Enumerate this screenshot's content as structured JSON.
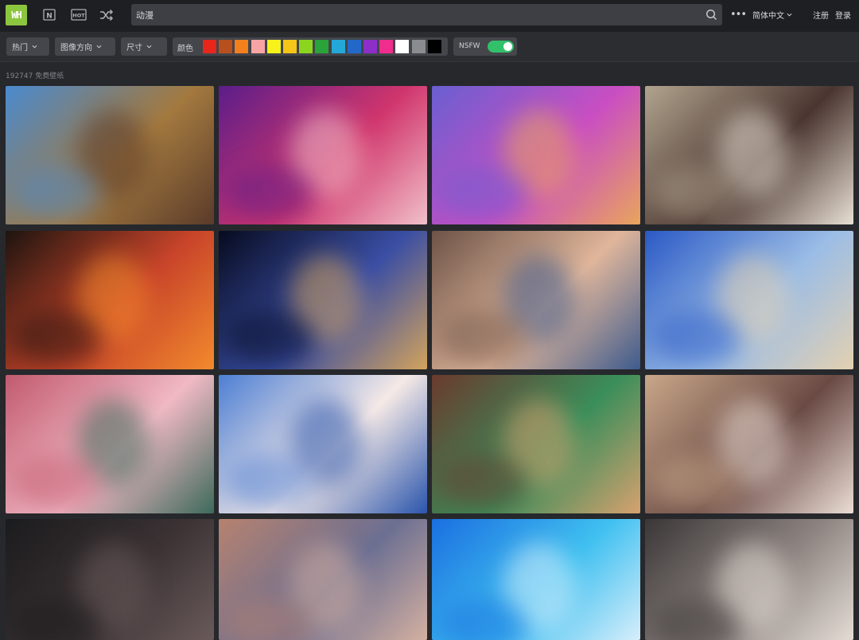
{
  "app": {
    "logo_text": "WH",
    "accent": "#8cc63e"
  },
  "nav": {
    "new_icon_label": "N",
    "hot_icon_label": "HOT",
    "random_icon": "shuffle-icon"
  },
  "search": {
    "value": "动漫",
    "icon": "search-icon"
  },
  "header": {
    "more_icon": "more-icon",
    "language": "简体中文",
    "register": "注册",
    "login": "登录"
  },
  "filters": {
    "hot": "热门",
    "orientation": "图像方向",
    "size": "尺寸",
    "color_label": "颜色",
    "colors": [
      "#e8261c",
      "#b8501e",
      "#f47f1d",
      "#f7a4a4",
      "#f7f21a",
      "#f5c518",
      "#8bd51f",
      "#2aa33a",
      "#24a8d8",
      "#2368c9",
      "#8c2ec7",
      "#ee2d8c",
      "#ffffff",
      "#8a8c90",
      "#000000"
    ],
    "nsfw_label": "NSFW",
    "nsfw_on": true
  },
  "results": {
    "count_text": "192747 免费壁纸"
  },
  "wallpapers": [
    {
      "name": "wallpaper-anime-town-harbor",
      "colors": [
        "#4a8bd0",
        "#a3793f",
        "#5a3b2a"
      ]
    },
    {
      "name": "wallpaper-anime-red-hair-girl",
      "colors": [
        "#5b1d8a",
        "#d0356c",
        "#f1c0c9"
      ]
    },
    {
      "name": "wallpaper-anime-witch-city",
      "colors": [
        "#6a5fd1",
        "#c94ec2",
        "#e9a55c"
      ]
    },
    {
      "name": "wallpaper-anime-group-city",
      "colors": [
        "#b1a48e",
        "#4a3530",
        "#e7dfd3"
      ]
    },
    {
      "name": "wallpaper-anime-flame-haze",
      "colors": [
        "#1d140f",
        "#c8442a",
        "#f28a2c"
      ]
    },
    {
      "name": "wallpaper-anime-night-sky-kids",
      "colors": [
        "#070b1f",
        "#3a4ea4",
        "#d3a35c"
      ]
    },
    {
      "name": "wallpaper-anime-couple-scarf",
      "colors": [
        "#6d5347",
        "#e0b69b",
        "#3e5b8d"
      ]
    },
    {
      "name": "wallpaper-anime-blue-pixelated",
      "colors": [
        "#2a59c5",
        "#9bbde6",
        "#e3d0b1"
      ]
    },
    {
      "name": "wallpaper-anime-fox-mask-pixelated",
      "colors": [
        "#c25a6f",
        "#f0b9c4",
        "#3d6a5b"
      ]
    },
    {
      "name": "wallpaper-anime-blue-hair-girl",
      "colors": [
        "#4d7fd4",
        "#f5e9e6",
        "#2a55ac"
      ]
    },
    {
      "name": "wallpaper-anime-cafe-pixelated",
      "colors": [
        "#6a3a2d",
        "#3a8e5a",
        "#d6a16f"
      ]
    },
    {
      "name": "wallpaper-anime-room-pixelated",
      "colors": [
        "#c9a78a",
        "#6a4a44",
        "#eaddd5"
      ]
    },
    {
      "name": "wallpaper-anime-dark-pixelated",
      "colors": [
        "#1b1b1d",
        "#3b3234",
        "#6a5a5a"
      ]
    },
    {
      "name": "wallpaper-anime-crowd-pixelated",
      "colors": [
        "#b6826f",
        "#6c6f92",
        "#d4b0a0"
      ]
    },
    {
      "name": "wallpaper-anime-blue-light-pixelated",
      "colors": [
        "#1a6fe0",
        "#40c0f0",
        "#d7eefb"
      ]
    },
    {
      "name": "wallpaper-anime-snow-girl",
      "colors": [
        "#3b3737",
        "#8d8481",
        "#e3dcd4"
      ]
    }
  ]
}
